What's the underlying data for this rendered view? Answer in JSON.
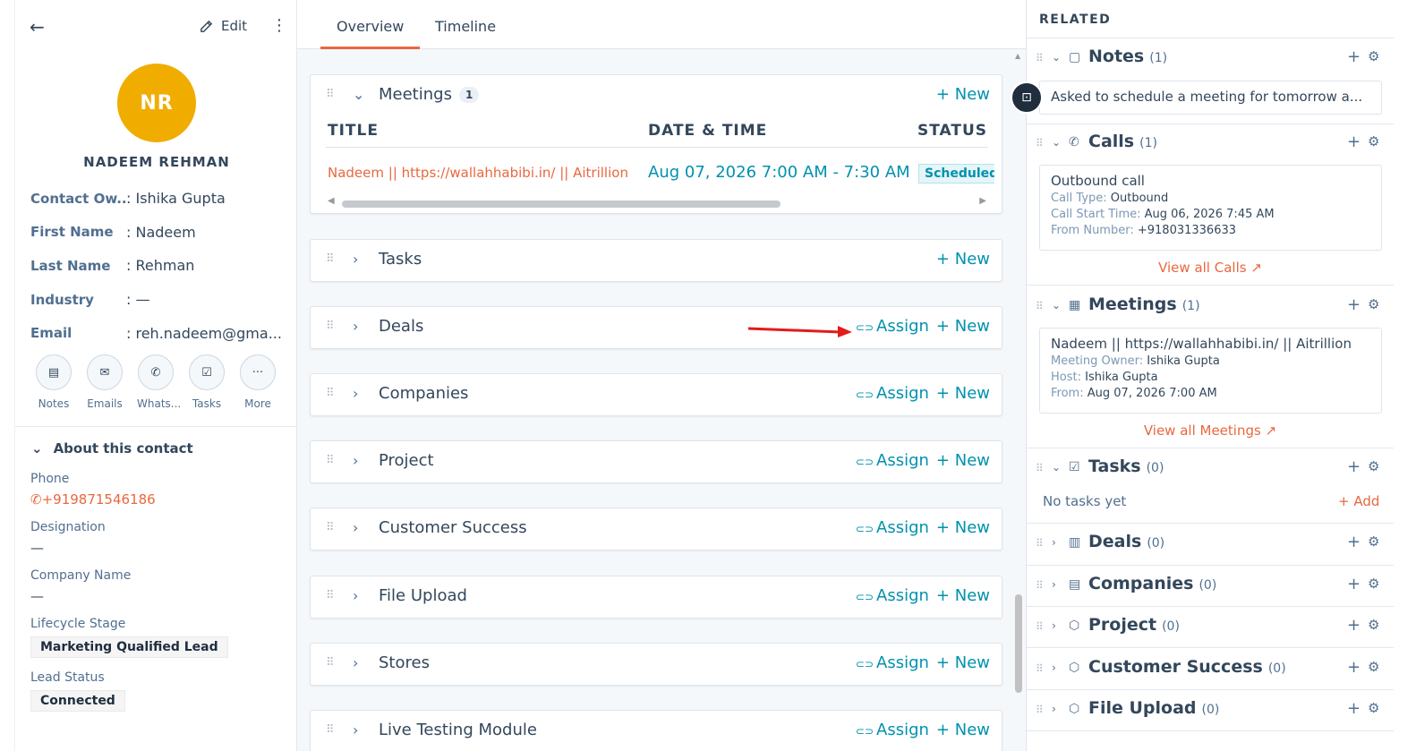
{
  "left": {
    "edit_label": "Edit",
    "avatar_initials": "NR",
    "contact_name": "NADEEM REHMAN",
    "properties": [
      {
        "key": "Contact Ow...",
        "value": ": Ishika Gupta"
      },
      {
        "key": "First Name",
        "value": ": Nadeem"
      },
      {
        "key": "Last Name",
        "value": ": Rehman"
      },
      {
        "key": "Industry",
        "value": ": —"
      },
      {
        "key": "Email",
        "value": ": reh.nadeem@gma..."
      }
    ],
    "actions": [
      {
        "label": "Notes",
        "icon": "note-icon"
      },
      {
        "label": "Emails",
        "icon": "mail-icon"
      },
      {
        "label": "Whats...",
        "icon": "whatsapp-icon"
      },
      {
        "label": "Tasks",
        "icon": "task-icon"
      },
      {
        "label": "More",
        "icon": "more-icon"
      }
    ],
    "about_title": "About this contact",
    "about": {
      "phone_label": "Phone",
      "phone_value": "+919871546186",
      "designation_label": "Designation",
      "designation_value": "—",
      "company_label": "Company Name",
      "company_value": "—",
      "lifecycle_label": "Lifecycle Stage",
      "lifecycle_value": "Marketing Qualified Lead",
      "lead_label": "Lead Status",
      "lead_value": "Connected"
    }
  },
  "middle": {
    "tabs": [
      "Overview",
      "Timeline"
    ],
    "meetings": {
      "title": "Meetings",
      "count": "1",
      "new_label": "+ New",
      "col_title": "TITLE",
      "col_date": "DATE & TIME",
      "col_status": "STATUS",
      "row_title": "Nadeem || https://wallahhabibi.in/ || Aitrillion",
      "row_date": "Aug 07, 2026 7:00 AM - 7:30 AM",
      "row_status": "Scheduled"
    },
    "tasks_title": "Tasks",
    "assign_label": "Assign",
    "new_label": "+ New",
    "sections": [
      "Deals",
      "Companies",
      "Project",
      "Customer Success",
      "File Upload",
      "Stores",
      "Live Testing Module"
    ]
  },
  "right": {
    "header": "RELATED",
    "notes": {
      "title": "Notes",
      "count": "(1)",
      "preview": "Asked to schedule a meeting for tomorrow a..."
    },
    "calls": {
      "title": "Calls",
      "count": "(1)",
      "card_title": "Outbound call",
      "type_label": "Call Type:",
      "type_value": "Outbound",
      "start_label": "Call Start Time:",
      "start_value": "Aug 06, 2026 7:45 AM",
      "from_label": "From Number:",
      "from_value": "+918031336633",
      "view_all": "View all Calls"
    },
    "meetings": {
      "title": "Meetings",
      "count": "(1)",
      "card_title": "Nadeem || https://wallahhabibi.in/ || Aitrillion",
      "owner_label": "Meeting Owner:",
      "owner_value": "Ishika Gupta",
      "host_label": "Host:",
      "host_value": "Ishika Gupta",
      "from_label": "From:",
      "from_value": "Aug 07, 2026 7:00 AM",
      "view_all": "View all Meetings"
    },
    "tasks": {
      "title": "Tasks",
      "count": "(0)",
      "empty": "No tasks yet",
      "add": "+ Add"
    },
    "deals": {
      "title": "Deals",
      "count": "(0)"
    },
    "companies": {
      "title": "Companies",
      "count": "(0)"
    },
    "project": {
      "title": "Project",
      "count": "(0)"
    },
    "customer_success": {
      "title": "Customer Success",
      "count": "(0)"
    },
    "file_upload": {
      "title": "File Upload",
      "count": "(0)"
    }
  },
  "colors": {
    "accent": "#e8683f",
    "link": "#0091ae",
    "avatar": "#f0ad00"
  }
}
